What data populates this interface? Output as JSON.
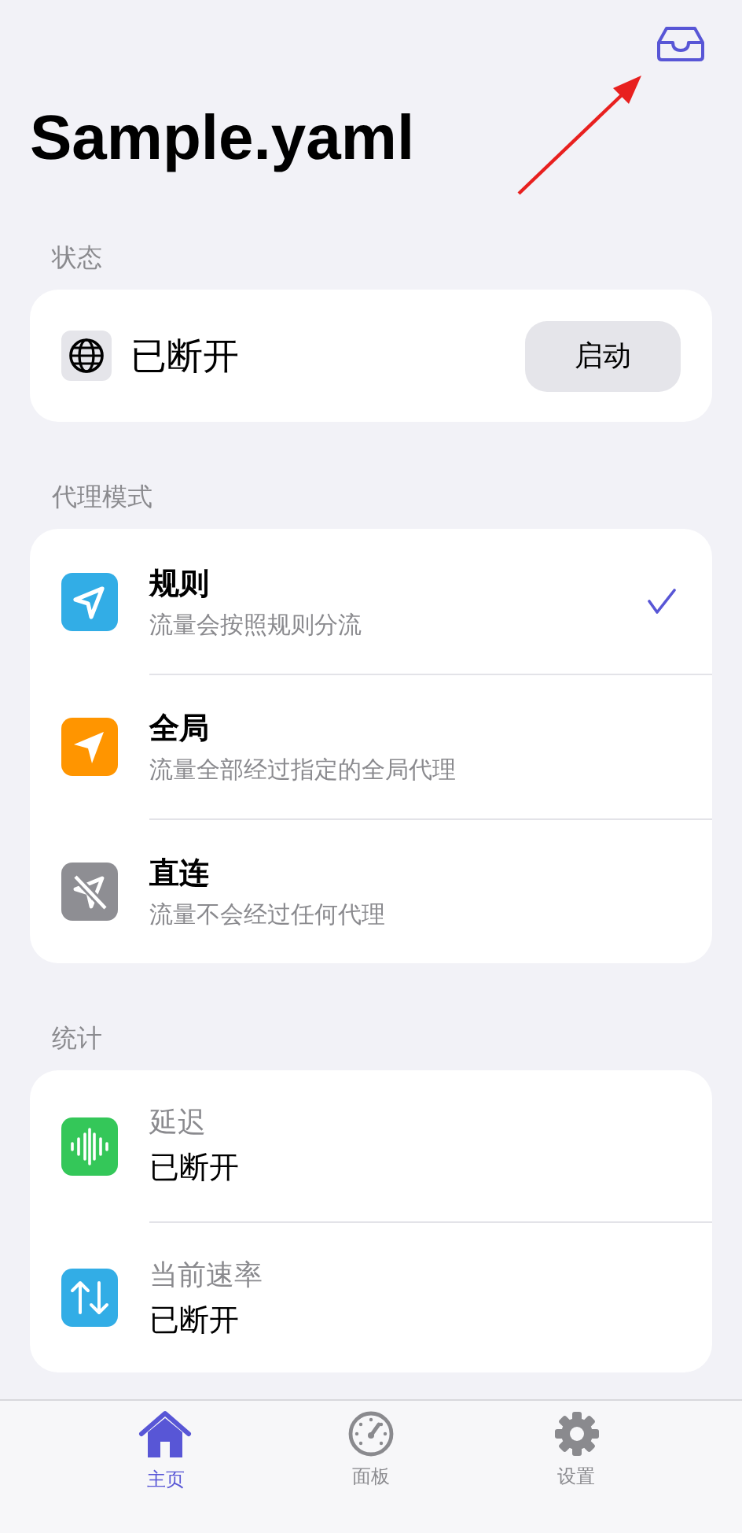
{
  "header": {
    "title": "Sample.yaml"
  },
  "status_section": {
    "label": "状态",
    "status": "已断开",
    "button": "启动"
  },
  "mode_section": {
    "label": "代理模式",
    "modes": [
      {
        "kind": "rule",
        "color": "#32ade6",
        "title": "规则",
        "subtitle": "流量会按照规则分流",
        "selected": true
      },
      {
        "kind": "global",
        "color": "#ff9500",
        "title": "全局",
        "subtitle": "流量全部经过指定的全局代理",
        "selected": false
      },
      {
        "kind": "direct",
        "color": "#8e8e93",
        "title": "直连",
        "subtitle": "流量不会经过任何代理",
        "selected": false
      }
    ]
  },
  "stats_section": {
    "label": "统计",
    "stats": [
      {
        "kind": "latency",
        "color": "#34c759",
        "label": "延迟",
        "value": "已断开"
      },
      {
        "kind": "speed",
        "color": "#32ade6",
        "label": "当前速率",
        "value": "已断开"
      }
    ]
  },
  "tab_bar": [
    {
      "kind": "home",
      "label": "主页",
      "selected": true
    },
    {
      "kind": "dashboard",
      "label": "面板",
      "selected": false
    },
    {
      "kind": "settings",
      "label": "设置",
      "selected": false
    }
  ]
}
